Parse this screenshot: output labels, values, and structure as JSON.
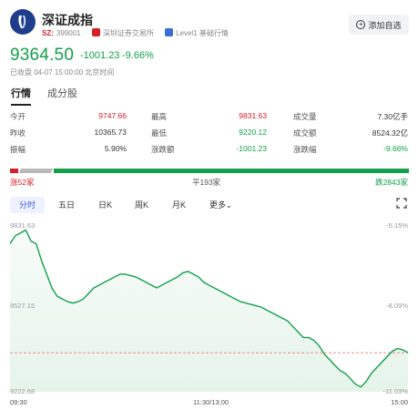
{
  "header": {
    "name": "深证成指",
    "code_prefix": "SZ:",
    "code": "399001",
    "exchange": "深圳证券交易所",
    "level": "Level1 基础行情",
    "add_button": "添加自选"
  },
  "quote": {
    "price": "9364.50",
    "change": "-1001.23",
    "change_pct": "-9.66%",
    "close_time": "已收盘 04-07 15:00:00 北京时间"
  },
  "tabs": [
    "行情",
    "成分股"
  ],
  "stats": {
    "rows": [
      [
        {
          "label": "今开",
          "value": "9747.66"
        },
        {
          "label": "最高",
          "value": "9831.63"
        },
        {
          "label": "成交量",
          "value": "7.30亿手"
        }
      ],
      [
        {
          "label": "昨收",
          "value": "10365.73"
        },
        {
          "label": "最低",
          "value": "9220.12"
        },
        {
          "label": "成交额",
          "value": "8524.32亿"
        }
      ],
      [
        {
          "label": "振幅",
          "value": "5.90%"
        },
        {
          "label": "涨跌额",
          "value": "-1001.23"
        },
        {
          "label": "涨跌幅",
          "value": "-9.66%"
        }
      ]
    ]
  },
  "breadth": {
    "up": "涨52家",
    "flat": "平193家",
    "down": "跌2843家",
    "colors": {
      "up": "#d61f26",
      "down": "#13a04a",
      "flat": "#b9b9b9"
    }
  },
  "chart_tabs": [
    "分时",
    "五日",
    "日K",
    "周K",
    "月K",
    "更多"
  ],
  "chart_data": {
    "type": "area",
    "y_left_ticks": [
      "9831.63",
      "9527.15",
      "9222.68"
    ],
    "y_right_ticks": [
      "-5.15%",
      "-8.09%",
      "-11.03%"
    ],
    "x_ticks": [
      "09:30",
      "11:30/13:00",
      "15:00"
    ],
    "ylim": [
      9222.68,
      9831.63
    ],
    "reference_price": 9364.5,
    "series": [
      {
        "values": [
          9760,
          9790,
          9800,
          9810,
          9770,
          9760,
          9700,
          9650,
          9600,
          9570,
          9560,
          9550,
          9545,
          9550,
          9560,
          9580,
          9600,
          9610,
          9620,
          9630,
          9640,
          9650,
          9650,
          9645,
          9640,
          9630,
          9620,
          9610,
          9600,
          9610,
          9620,
          9630,
          9640,
          9655,
          9660,
          9650,
          9640,
          9620,
          9610,
          9600,
          9590,
          9580,
          9570,
          9560,
          9550,
          9545,
          9540,
          9535,
          9530,
          9520,
          9510,
          9500,
          9490,
          9480,
          9460,
          9440,
          9420,
          9420,
          9410,
          9390,
          9360,
          9340,
          9320,
          9300,
          9290,
          9270,
          9250,
          9240,
          9260,
          9290,
          9310,
          9330,
          9350,
          9370,
          9380,
          9375,
          9365
        ]
      }
    ],
    "colors": {
      "line": "#13a04a",
      "fill": "#e6f4ea",
      "ref_line": "#e06b6b"
    }
  }
}
